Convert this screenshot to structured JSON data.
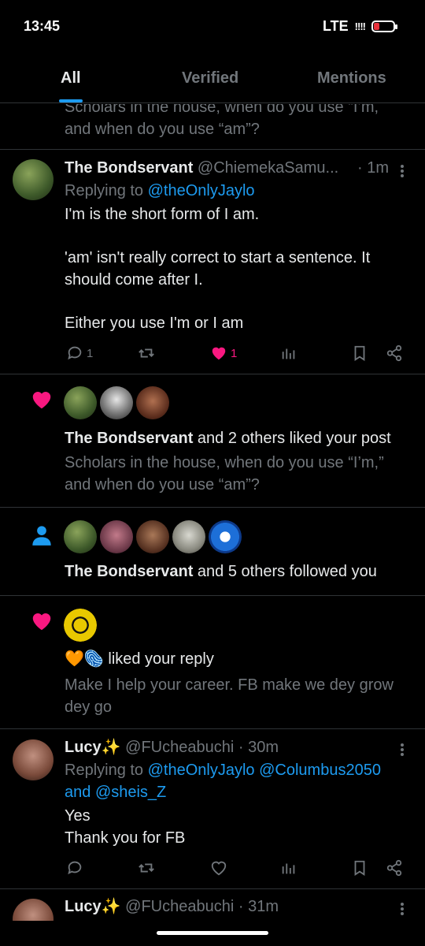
{
  "status": {
    "time": "13:45",
    "network": "LTE",
    "signal": "!!!!"
  },
  "tabs": [
    {
      "label": "All"
    },
    {
      "label": "Verified"
    },
    {
      "label": "Mentions"
    }
  ],
  "top_post": {
    "line1": "Scholars in the house, when do you use “I’m,",
    "line2": "and when do you use “am”?"
  },
  "reply1": {
    "name": "The Bondservant",
    "handle": "@ChiemekaSamu...",
    "time": "· 1m",
    "replying_prefix": "Replying to ",
    "replying_to": "@theOnlyJaylo",
    "text1": "I'm is the short form of I am.",
    "text2": "'am' isn't really correct to start a sentence. It",
    "text3": "should come after I.",
    "text4": "Either you use I'm or I am",
    "reply_count": "1",
    "like_count": "1"
  },
  "like_notif": {
    "actor": "The Bondservant",
    "rest": " and 2 others liked your post",
    "line1": "Scholars in the house, when do you use “I’m,”",
    "line2": "and when do you use “am”?"
  },
  "follow_notif": {
    "actor": "The Bondservant",
    "rest": " and 5 others followed you"
  },
  "reply_like_notif": {
    "emojis": "🧡🫆",
    "rest": " liked your reply",
    "line1": "Make I help your career. FB make we dey grow",
    "line2": "dey go"
  },
  "reply2": {
    "name": "Lucy✨",
    "handle": "@FUcheabuchi",
    "time": "· 30m",
    "replying_prefix": "Replying to ",
    "replying_to_1": "@theOnlyJaylo",
    "replying_to_2": "@Columbus2050",
    "and": "and ",
    "replying_to_3": "@sheis_Z",
    "text1": "Yes",
    "text2": "Thank you for FB"
  },
  "reply3": {
    "name": "Lucy✨",
    "handle": "@FUcheabuchi",
    "time": "· 31m"
  },
  "colors": {
    "accent": "#1d9bf0",
    "like": "#f91880",
    "muted": "#71767b",
    "text": "#e7e9ea",
    "battery": "#e8323c"
  },
  "icons": [
    "reply-icon",
    "retweet-icon",
    "heart-icon",
    "views-icon",
    "bookmark-icon",
    "share-icon",
    "person-icon",
    "more-icon"
  ]
}
